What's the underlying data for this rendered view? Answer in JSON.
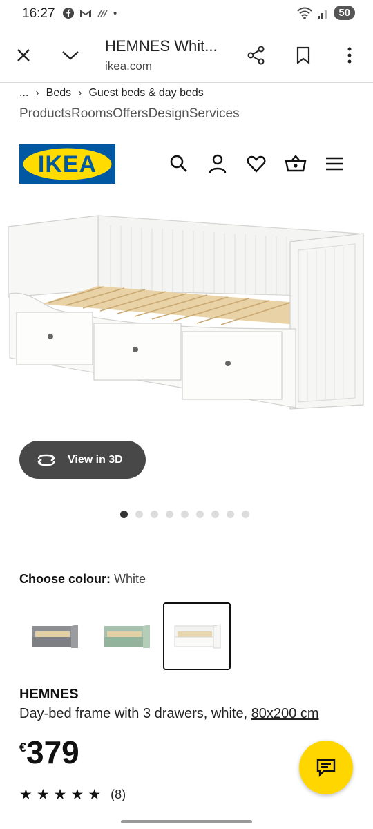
{
  "status_bar": {
    "time": "16:27",
    "battery": "50"
  },
  "toolbar": {
    "title": "HEMNES Whit...",
    "url": "ikea.com"
  },
  "breadcrumb": {
    "ellipsis": "...",
    "items": [
      "Beds",
      "Guest beds & day beds"
    ]
  },
  "nav": {
    "links": [
      "Products",
      "Rooms",
      "Offers",
      "Design",
      "Services"
    ]
  },
  "logo": {
    "text": "IKEA",
    "colors": {
      "blue": "#0058a3",
      "yellow": "#ffdb00"
    }
  },
  "view3d": {
    "label": "View in 3D"
  },
  "gallery": {
    "total_images": 9,
    "active_index": 0
  },
  "colour": {
    "label": "Choose colour:",
    "value": "White",
    "options": [
      "grey",
      "green",
      "white"
    ],
    "selected_index": 2
  },
  "product": {
    "name": "HEMNES",
    "description": "Day-bed frame with 3 drawers, white, ",
    "size_link": "80x200 cm",
    "currency": "€",
    "price": "379",
    "rating_count": "(8)",
    "rating_stars": 5
  },
  "accent": {
    "chat_fab": "#ffd600",
    "view3d_bg": "#484848"
  }
}
